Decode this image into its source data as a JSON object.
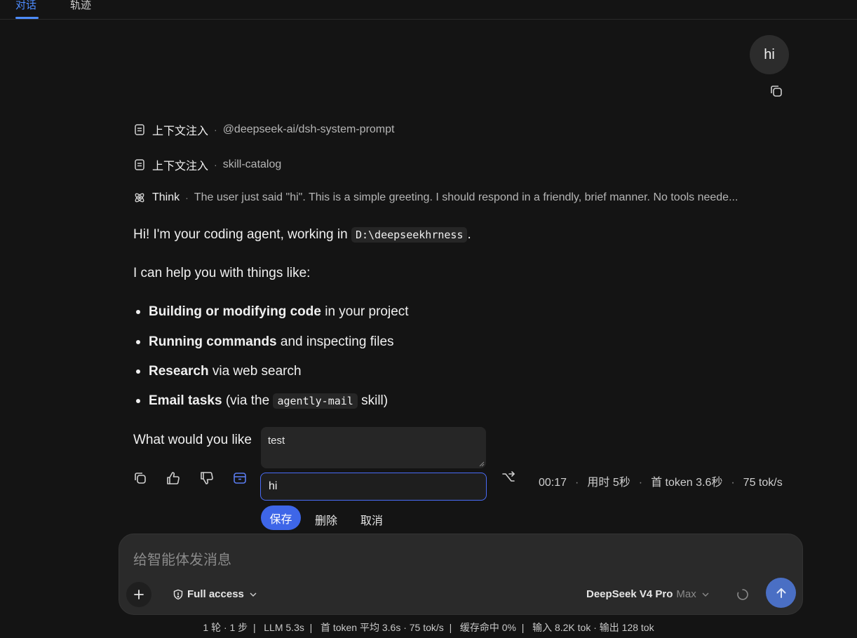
{
  "tabs": [
    {
      "label": "对话",
      "active": true
    },
    {
      "label": "轨迹",
      "active": false
    }
  ],
  "user_message": "hi",
  "context_items": [
    {
      "icon": "document-icon",
      "title": "上下文注入",
      "detail": "@deepseek-ai/dsh-system-prompt"
    },
    {
      "icon": "document-icon",
      "title": "上下文注入",
      "detail": "skill-catalog"
    },
    {
      "icon": "atom-icon",
      "title": "Think",
      "detail": "The user just said \"hi\". This is a simple greeting. I should respond in a friendly, brief manner. No tools neede..."
    }
  ],
  "reply": {
    "intro_before": "Hi! I'm your coding agent, working in",
    "intro_code": "D:\\deepseekhrness",
    "intro_after": ".",
    "help_line": "I can help you with things like:",
    "items": [
      {
        "bold": "Building or modifying code",
        "rest": " in your project"
      },
      {
        "bold": "Running commands",
        "rest": " and inspecting files"
      },
      {
        "bold": "Research",
        "rest": " via web search"
      },
      {
        "bold": "Email tasks",
        "rest_before": " (via the ",
        "code": "agently-mail",
        "rest_after": " skill)"
      }
    ],
    "closing_visible": "What would you like"
  },
  "stats": {
    "time": "00:17",
    "duration": "用时 5秒",
    "first_token": "首 token 3.6秒",
    "speed": "75 tok/s"
  },
  "edit": {
    "textarea_value": "test",
    "input_value": "hi",
    "save_label": "保存",
    "delete_label": "删除",
    "cancel_label": "取消"
  },
  "composer": {
    "placeholder": "给智能体发消息",
    "access_label": "Full access",
    "model_name": "DeepSeek V4 Pro",
    "model_tier": "Max"
  },
  "footer": "1 轮 · 1 步  |   LLM 5.3s  |   首 token 平均 3.6s · 75 tok/s  |   缓存命中 0%  |   输入 8.2K tok · 输出 128 tok",
  "colors": {
    "background": "#141414",
    "accent": "#4d8cff",
    "save_button": "#3e66e8",
    "send_button": "#4a6fc4"
  }
}
